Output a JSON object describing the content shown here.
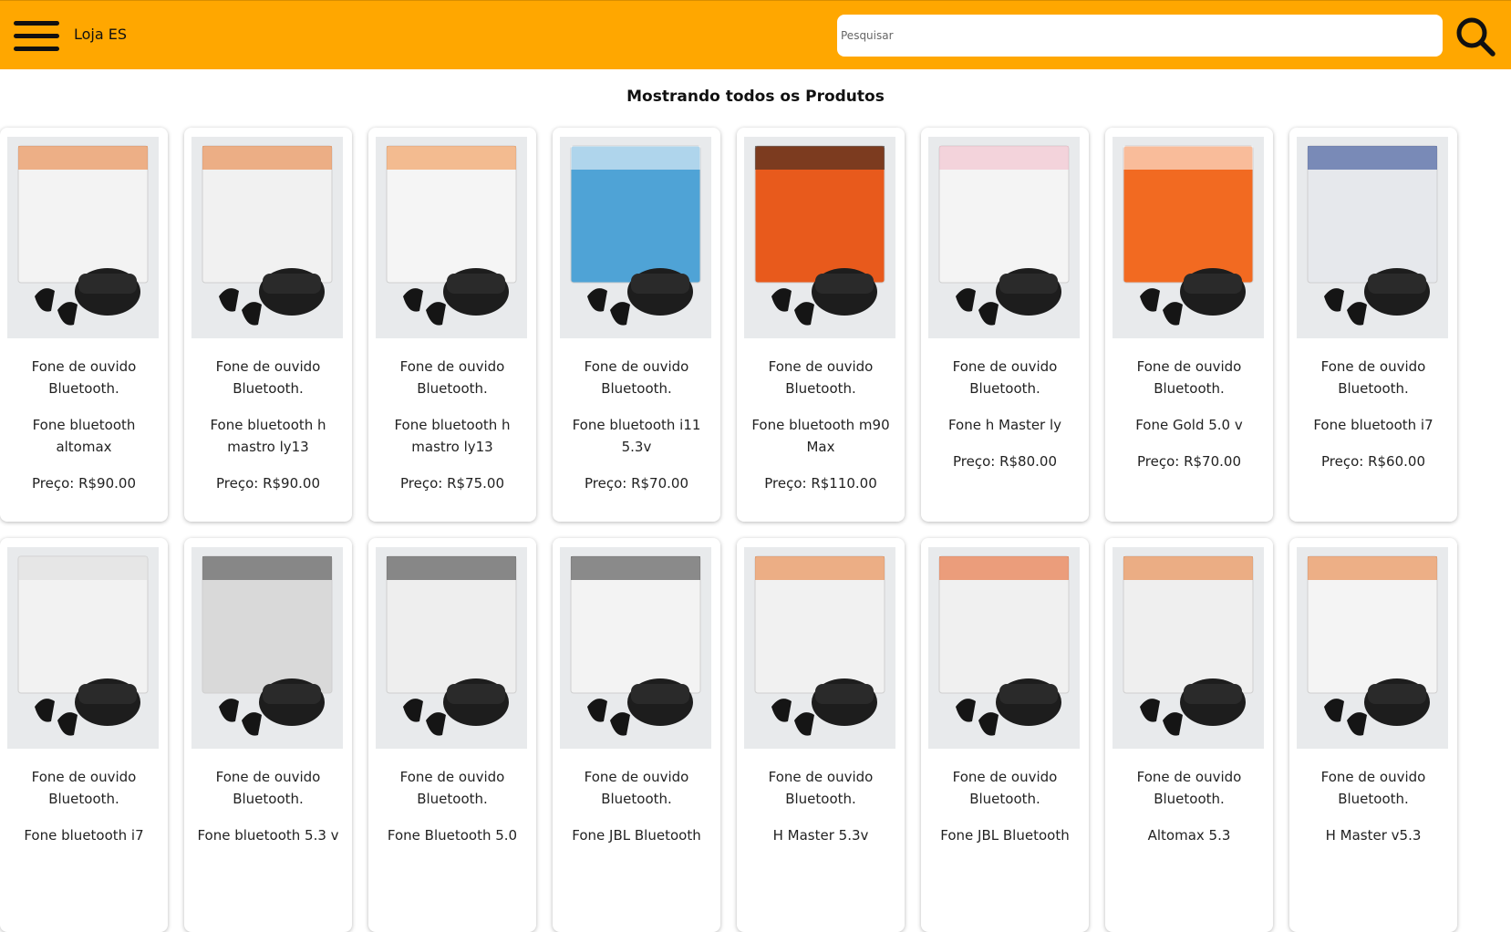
{
  "header": {
    "store_name": "Loja ES",
    "search_placeholder": "Pesquisar",
    "accent_color": "#ffa700"
  },
  "page_title": "Mostrando todos os Produtos",
  "products": [
    {
      "description": "Fone de ouvido Bluetooth.",
      "name": "Fone bluetooth altomax",
      "price": "Preço: R$90.00",
      "theme": "#f3f3f3",
      "accent": "#e8762b"
    },
    {
      "description": "Fone de ouvido Bluetooth.",
      "name": "Fone bluetooth h mastro ly13",
      "price": "Preço: R$90.00",
      "theme": "#f1f1f1",
      "accent": "#e8762b"
    },
    {
      "description": "Fone de ouvido Bluetooth.",
      "name": "Fone bluetooth h mastro ly13",
      "price": "Preço: R$75.00",
      "theme": "#f5f5f5",
      "accent": "#f08a3c"
    },
    {
      "description": "Fone de ouvido Bluetooth.",
      "name": "Fone bluetooth i11 5.3v",
      "price": "Preço: R$70.00",
      "theme": "#4fa3d6",
      "accent": "#ffffff"
    },
    {
      "description": "Fone de ouvido Bluetooth.",
      "name": "Fone bluetooth m90 Max",
      "price": "Preço: R$110.00",
      "theme": "#e85a1c",
      "accent": "#222222"
    },
    {
      "description": "Fone de ouvido Bluetooth.",
      "name": "Fone h Master ly",
      "price": "Preço: R$80.00",
      "theme": "#f4f4f4",
      "accent": "#f2b8c6"
    },
    {
      "description": "Fone de ouvido Bluetooth.",
      "name": "Fone Gold 5.0 v",
      "price": "Preço: R$70.00",
      "theme": "#f26a21",
      "accent": "#ffffff"
    },
    {
      "description": "Fone de ouvido Bluetooth.",
      "name": "Fone bluetooth i7",
      "price": "Preço: R$60.00",
      "theme": "#e6e8ec",
      "accent": "#1f3c8c"
    },
    {
      "description": "Fone de ouvido Bluetooth.",
      "name": "Fone bluetooth i7",
      "price": "",
      "theme": "#f2f2f2",
      "accent": "#dddddd"
    },
    {
      "description": "Fone de ouvido Bluetooth.",
      "name": "Fone bluetooth 5.3 v",
      "price": "",
      "theme": "#d9d9d9",
      "accent": "#444444"
    },
    {
      "description": "Fone de ouvido Bluetooth.",
      "name": "Fone Bluetooth 5.0",
      "price": "",
      "theme": "#eeeeee",
      "accent": "#333333"
    },
    {
      "description": "Fone de ouvido Bluetooth.",
      "name": "Fone JBL Bluetooth",
      "price": "",
      "theme": "#f3f3f3",
      "accent": "#333333"
    },
    {
      "description": "Fone de ouvido Bluetooth.",
      "name": "H Master 5.3v",
      "price": "",
      "theme": "#f1f1f1",
      "accent": "#e8762b"
    },
    {
      "description": "Fone de ouvido Bluetooth.",
      "name": "Fone JBL Bluetooth",
      "price": "",
      "theme": "#f0f0f0",
      "accent": "#e85a1c"
    },
    {
      "description": "Fone de ouvido Bluetooth.",
      "name": "Altomax 5.3",
      "price": "",
      "theme": "#efefef",
      "accent": "#e8762b"
    },
    {
      "description": "Fone de ouvido Bluetooth.",
      "name": "H Master v5.3",
      "price": "",
      "theme": "#f4f4f4",
      "accent": "#e8762b"
    }
  ]
}
